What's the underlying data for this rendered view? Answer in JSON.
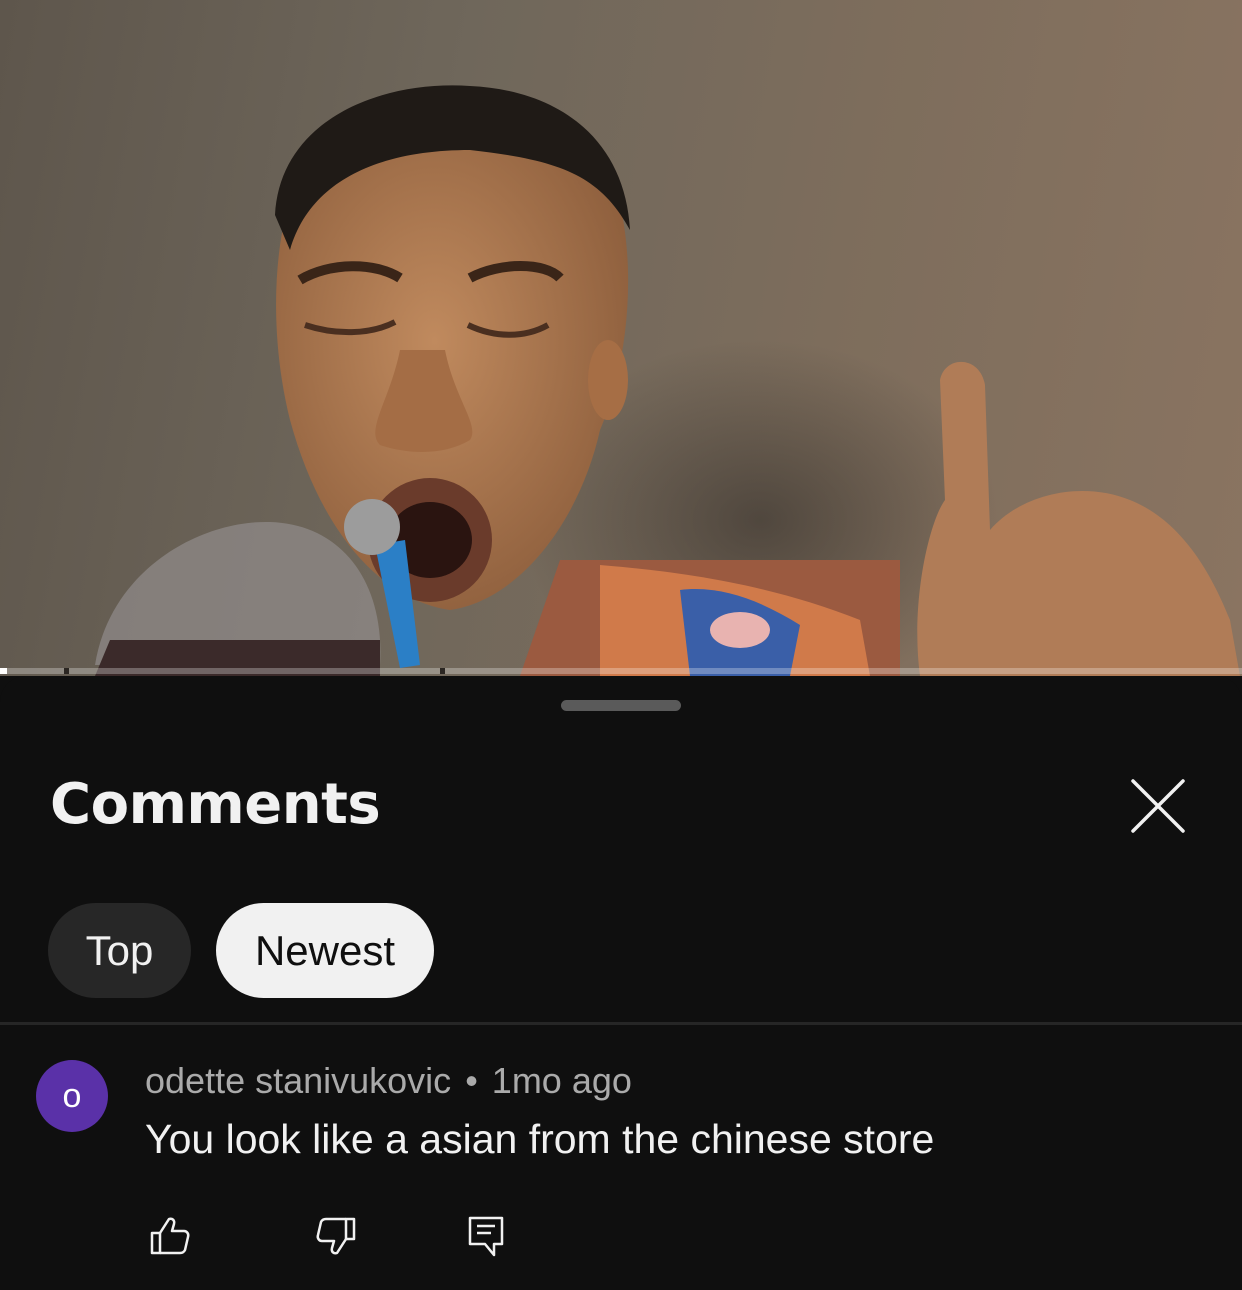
{
  "video": {
    "progress_fraction": 0.006
  },
  "comments_panel": {
    "title": "Comments",
    "close_icon": "close-icon",
    "sort_chips": [
      {
        "label": "Top",
        "selected": false
      },
      {
        "label": "Newest",
        "selected": true
      }
    ],
    "comments": [
      {
        "avatar_letter": "o",
        "avatar_color": "#5a31a8",
        "author": "odette stanivukovic",
        "separator": "•",
        "time": "1mo ago",
        "text": "You look like a asian from the chinese store",
        "actions": [
          "thumb-up-icon",
          "thumb-down-icon",
          "reply-icon"
        ]
      }
    ]
  },
  "colors": {
    "sheet_background": "#0f0f0f",
    "chip_selected_bg": "#f1f1f1",
    "chip_unselected_bg": "#272727",
    "secondary_text": "#aaaaaa",
    "primary_text": "#f1f1f1"
  }
}
